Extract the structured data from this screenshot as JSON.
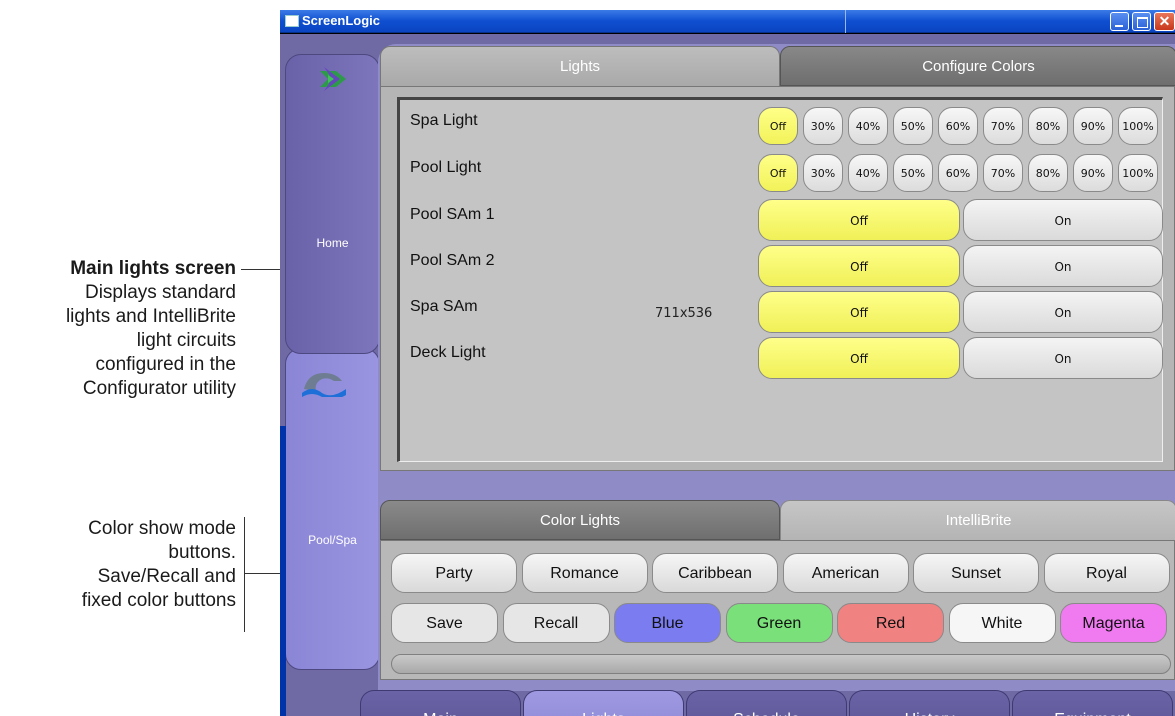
{
  "annotations": {
    "lights_title": "Main lights screen",
    "lights_lines": [
      "Displays standard",
      "lights and IntelliBrite",
      "light circuits",
      "configured in the",
      "Configurator utility"
    ],
    "color_lines": [
      "Color show mode",
      "buttons.",
      "Save/Recall and",
      "fixed color buttons"
    ]
  },
  "window": {
    "title": "ScreenLogic",
    "min_icon": "minimize-icon",
    "max_icon": "maximize-icon",
    "close_icon": "close-icon",
    "close_glyph": "✕"
  },
  "side_nav": {
    "home_label": "Home",
    "home_icon": "home-arrow-icon",
    "pool_label": "Pool/Spa",
    "pool_icon": "pool-wave-icon"
  },
  "top_tabs": {
    "lights": "Lights",
    "configure": "Configure Colors"
  },
  "dimmer_labels": [
    "Off",
    "30%",
    "40%",
    "50%",
    "60%",
    "70%",
    "80%",
    "90%",
    "100%"
  ],
  "dimmer_lights": [
    {
      "name": "Spa Light",
      "selected": "Off"
    },
    {
      "name": "Pool Light",
      "selected": "Off"
    }
  ],
  "onoff_lights": [
    {
      "name": "Pool SAm 1",
      "off": "Off",
      "on": "On",
      "selected": "Off"
    },
    {
      "name": "Pool SAm 2",
      "off": "Off",
      "on": "On",
      "selected": "Off"
    },
    {
      "name": "Spa SAm",
      "off": "Off",
      "on": "On",
      "selected": "Off"
    },
    {
      "name": "Deck Light",
      "off": "Off",
      "on": "On",
      "selected": "Off"
    }
  ],
  "dimension_label": "711x536",
  "bottom_tabs": {
    "color_lights": "Color Lights",
    "intellibrite": "IntelliBrite"
  },
  "show_modes": [
    "Party",
    "Romance",
    "Caribbean",
    "American",
    "Sunset",
    "Royal"
  ],
  "fixed_buttons": [
    {
      "label": "Save",
      "color": "#e6e6e6"
    },
    {
      "label": "Recall",
      "color": "#e6e6e6"
    },
    {
      "label": "Blue",
      "color": "#7a7cf0"
    },
    {
      "label": "Green",
      "color": "#7ae07a"
    },
    {
      "label": "Red",
      "color": "#f08282"
    },
    {
      "label": "White",
      "color": "#f6f6f6"
    },
    {
      "label": "Magenta",
      "color": "#f07af0"
    }
  ],
  "bottom_nav": [
    "Main",
    "Lights",
    "Schedule",
    "History",
    "Equipment"
  ],
  "bottom_nav_active": "Lights"
}
